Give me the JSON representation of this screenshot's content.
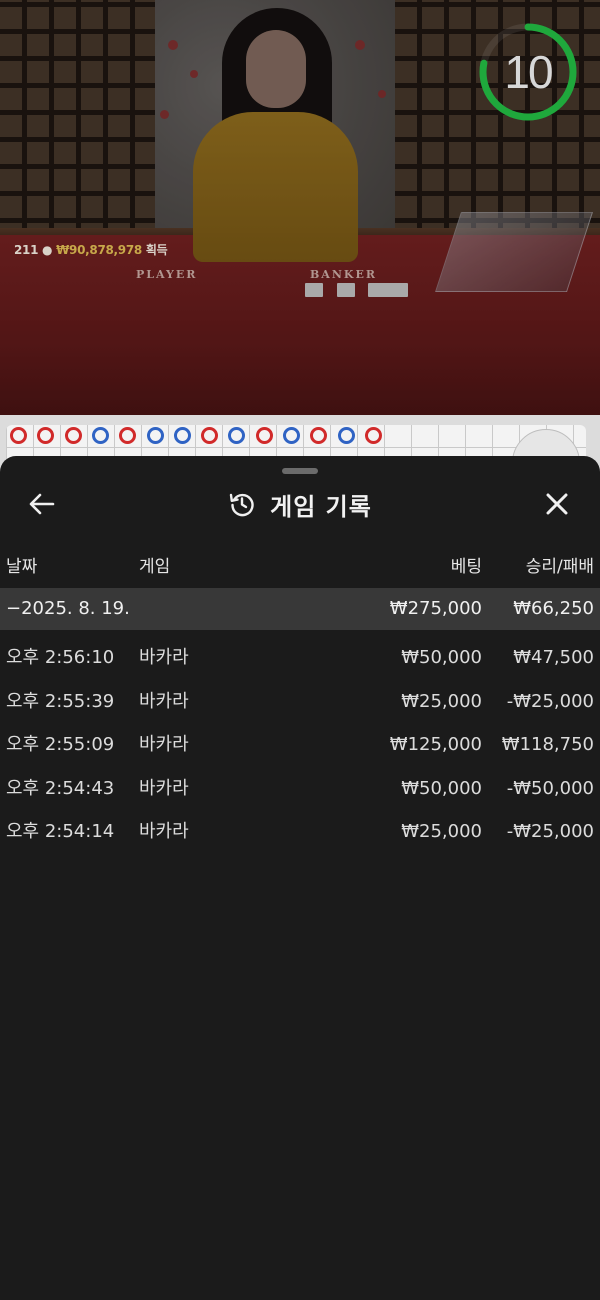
{
  "stream": {
    "winners_count": "211",
    "winners_amount": "₩90,878,978",
    "winners_suffix": "획득",
    "felt_player": "PLAYER",
    "felt_banker": "BANKER",
    "countdown": "10",
    "countdown_fraction": 0.78,
    "timer_color": "#1fa83c"
  },
  "bead_road": [
    "R",
    "R",
    "R",
    "B",
    "R",
    "B",
    "B",
    "R",
    "B",
    "R",
    "B",
    "R",
    "B",
    "R"
  ],
  "sheet": {
    "title": "게임 기록",
    "history_icon": "history-icon",
    "back_icon": "arrow-left-icon",
    "close_icon": "close-icon",
    "columns": {
      "date": "날짜",
      "game": "게임",
      "bet": "베팅",
      "result": "승리/패배"
    },
    "day_group": {
      "date": "−2025. 8. 19.",
      "bet": "₩275,000",
      "result": "₩66,250"
    },
    "rows": [
      {
        "time": "오후 2:56:10",
        "game": "바카라",
        "bet": "₩50,000",
        "result": "₩47,500"
      },
      {
        "time": "오후 2:55:39",
        "game": "바카라",
        "bet": "₩25,000",
        "result": "-₩25,000"
      },
      {
        "time": "오후 2:55:09",
        "game": "바카라",
        "bet": "₩125,000",
        "result": "₩118,750"
      },
      {
        "time": "오후 2:54:43",
        "game": "바카라",
        "bet": "₩50,000",
        "result": "-₩50,000"
      },
      {
        "time": "오후 2:54:14",
        "game": "바카라",
        "bet": "₩25,000",
        "result": "-₩25,000"
      }
    ]
  }
}
